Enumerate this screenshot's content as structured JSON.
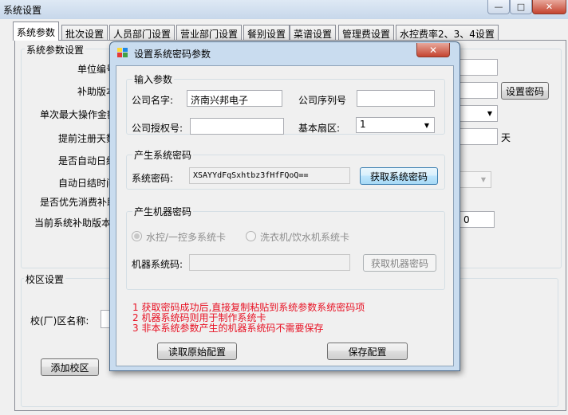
{
  "main_window": {
    "title": "系统设置",
    "controls": {
      "minimize": "—",
      "maximize": "□",
      "close": "✕"
    }
  },
  "tabs": [
    "系统参数",
    "批次设置",
    "人员部门设置",
    "营业部门设置",
    "餐别设置",
    "菜谱设置",
    "管理费设置",
    "水控费率2、3、4设置"
  ],
  "system_params": {
    "group_title": "系统参数设置",
    "labels": [
      "单位编号",
      "补助版本",
      "单次最大操作金额",
      "提前注册天数",
      "是否自动日结",
      "自动日结时间",
      "是否优先消费补助",
      "当前系统补助版本"
    ],
    "set_password_button": "设置密码",
    "days_unit": "天",
    "current_subsidy_value": "0"
  },
  "campus": {
    "group_title": "校区设置",
    "name_label": "校(厂)区名称:",
    "add_button": "添加校区"
  },
  "dialog": {
    "title": "设置系统密码参数",
    "close_glyph": "✕",
    "input_group": {
      "title": "输入参数",
      "company_name_label": "公司名字:",
      "company_name_value": "济南兴邦电子",
      "company_serial_label": "公司序列号",
      "company_serial_value": "",
      "company_auth_label": "公司授权号:",
      "company_auth_value": "",
      "base_sector_label": "基本扇区:",
      "base_sector_value": "1"
    },
    "system_password_group": {
      "title": "产生系统密码",
      "label": "系统密码:",
      "value": "XSAYYdFqSxhtbz3fHfFQoQ==",
      "button": "获取系统密码"
    },
    "machine_password_group": {
      "title": "产生机器密码",
      "radio_1": "水控/一控多系统卡",
      "radio_2": "洗衣机/饮水机系统卡",
      "label": "机器系统码:",
      "value": "",
      "button": "获取机器密码"
    },
    "notes": [
      "1 获取密码成功后,直接复制粘贴到系统参数系统密码项",
      "2 机器系统码则用于制作系统卡",
      "3 非本系统参数产生的机器系统码不需要保存"
    ],
    "read_button": "读取原始配置",
    "save_button": "保存配置"
  }
}
